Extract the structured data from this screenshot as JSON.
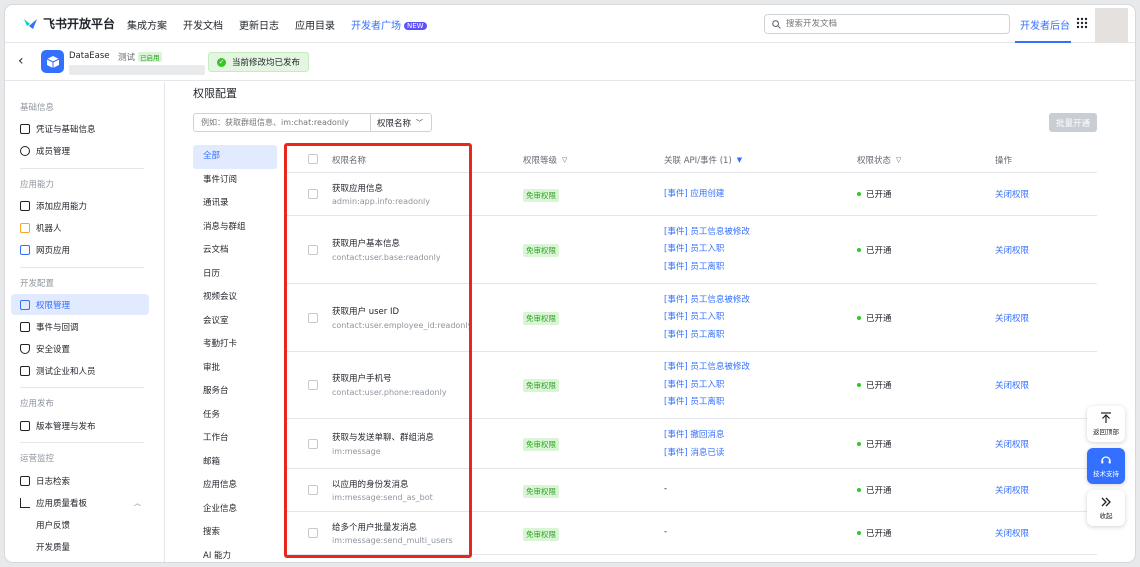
{
  "topnav": {
    "brand": "飞书开放平台",
    "links": [
      "集成方案",
      "开发文档",
      "更新日志",
      "应用目录"
    ],
    "dev_plaza": "开发者广场",
    "new_badge": "NEW",
    "search_placeholder": "搜索开发文档",
    "dev_backend": "开发者后台"
  },
  "app": {
    "name": "DataEase",
    "env": "测试",
    "env_status": "已启用",
    "saved_message": "当前修改均已发布"
  },
  "sidebar": {
    "sections": [
      {
        "title": "基础信息",
        "items": [
          "凭证与基础信息",
          "成员管理"
        ]
      },
      {
        "title": "应用能力",
        "items": [
          "添加应用能力",
          "机器人",
          "网页应用"
        ]
      },
      {
        "title": "开发配置",
        "items": [
          "权限管理",
          "事件与回调",
          "安全设置",
          "测试企业和人员"
        ]
      },
      {
        "title": "应用发布",
        "items": [
          "版本管理与发布"
        ]
      },
      {
        "title": "运营监控",
        "items": [
          "日志检索",
          "应用质量看板"
        ],
        "subitems": [
          "用户反馈",
          "开发质量"
        ]
      }
    ],
    "active_item": "权限管理"
  },
  "main": {
    "title": "权限配置",
    "filter_placeholder": "例如：获取群组信息、im:chat:readonly",
    "filter_select": "权限名称",
    "batch_button": "批量开通",
    "categories": [
      "全部",
      "事件订阅",
      "通讯录",
      "消息与群组",
      "云文档",
      "日历",
      "视频会议",
      "会议室",
      "考勤打卡",
      "审批",
      "服务台",
      "任务",
      "工作台",
      "邮箱",
      "应用信息",
      "企业信息",
      "搜索",
      "AI 能力"
    ],
    "active_category": "全部",
    "table": {
      "headers": {
        "name": "权限名称",
        "level": "权限等级",
        "api": "关联 API/事件 (1)",
        "status": "权限状态",
        "action": "操作"
      },
      "rows": [
        {
          "name": "获取应用信息",
          "code": "admin:app.info:readonly",
          "level": "免审权限",
          "apis": [
            "[事件] 应用创建"
          ],
          "status": "已开通",
          "action": "关闭权限"
        },
        {
          "name": "获取用户基本信息",
          "code": "contact:user.base:readonly",
          "level": "免审权限",
          "apis": [
            "[事件] 员工信息被修改",
            "[事件] 员工入职",
            "[事件] 员工离职"
          ],
          "status": "已开通",
          "action": "关闭权限"
        },
        {
          "name": "获取用户 user ID",
          "code": "contact:user.employee_id:readonly",
          "level": "免审权限",
          "apis": [
            "[事件] 员工信息被修改",
            "[事件] 员工入职",
            "[事件] 员工离职"
          ],
          "status": "已开通",
          "action": "关闭权限"
        },
        {
          "name": "获取用户手机号",
          "code": "contact:user.phone:readonly",
          "level": "免审权限",
          "apis": [
            "[事件] 员工信息被修改",
            "[事件] 员工入职",
            "[事件] 员工离职"
          ],
          "status": "已开通",
          "action": "关闭权限"
        },
        {
          "name": "获取与发送单聊、群组消息",
          "code": "im:message",
          "level": "免审权限",
          "apis": [
            "[事件] 撤回消息",
            "[事件] 消息已读"
          ],
          "status": "已开通",
          "action": "关闭权限"
        },
        {
          "name": "以应用的身份发消息",
          "code": "im:message:send_as_bot",
          "level": "免审权限",
          "apis": [],
          "empty_api": "-",
          "status": "已开通",
          "action": "关闭权限"
        },
        {
          "name": "给多个用户批量发消息",
          "code": "im:message:send_multi_users",
          "level": "免审权限",
          "apis": [],
          "empty_api": "-",
          "status": "已开通",
          "action": "关闭权限"
        }
      ]
    }
  },
  "float_buttons": {
    "top": "返回顶部",
    "support": "技术支持",
    "collapse": "收起"
  },
  "colors": {
    "accent": "#3370ff",
    "highlight_box": "#e8271e",
    "success": "#34c724"
  }
}
